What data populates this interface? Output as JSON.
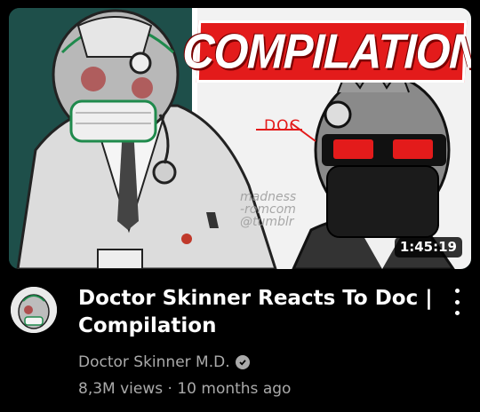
{
  "video": {
    "thumbnail_banner": "COMPILATION",
    "thumbnail_label": "DOC",
    "thumbnail_watermark": [
      "madness",
      "-romcom",
      "@tumblr"
    ],
    "duration": "1:45:19",
    "title_line1": "Doctor Skinner Reacts To Doc |",
    "title_line2": "Compilation",
    "channel": "Doctor Skinner M.D.",
    "views": "8,3M views",
    "separator": "·",
    "age": "10 months ago"
  },
  "icons": {
    "menu": "kebab-menu-icon",
    "verified": "verified-check-icon"
  },
  "colors": {
    "background": "#000000",
    "banner_red": "#e31b1b",
    "thumbnail_teal": "#1d4e49",
    "meta_gray": "#aaaaaa"
  }
}
